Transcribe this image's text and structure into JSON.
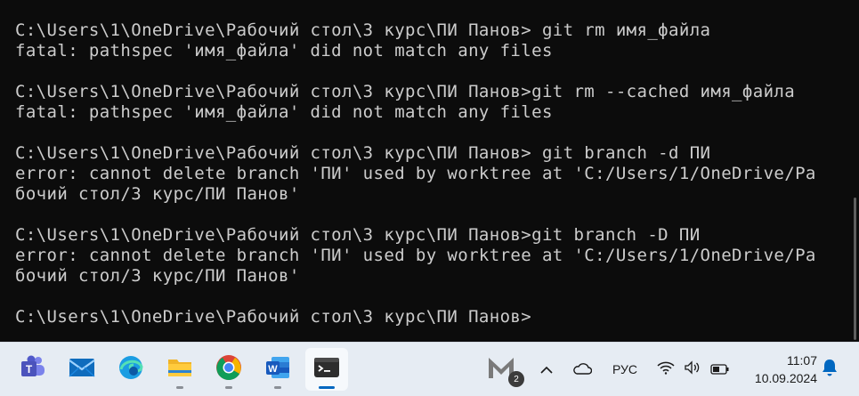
{
  "terminal": {
    "lines": [
      "C:\\Users\\1\\OneDrive\\Рабочий стол\\3 курс\\ПИ Панов> git rm имя_файла",
      "fatal: pathspec 'имя_файла' did not match any files",
      "",
      "C:\\Users\\1\\OneDrive\\Рабочий стол\\3 курс\\ПИ Панов>git rm --cached имя_файла",
      "fatal: pathspec 'имя_файла' did not match any files",
      "",
      "C:\\Users\\1\\OneDrive\\Рабочий стол\\3 курс\\ПИ Панов> git branch -d ПИ",
      "error: cannot delete branch 'ПИ' used by worktree at 'C:/Users/1/OneDrive/Ра",
      "бочий стол/3 курс/ПИ Панов'",
      "",
      "C:\\Users\\1\\OneDrive\\Рабочий стол\\3 курс\\ПИ Панов>git branch -D ПИ",
      "error: cannot delete branch 'ПИ' used by worktree at 'C:/Users/1/OneDrive/Ра",
      "бочий стол/3 курс/ПИ Панов'",
      "",
      "C:\\Users\\1\\OneDrive\\Рабочий стол\\3 курс\\ПИ Панов>"
    ]
  },
  "taskbar": {
    "apps": [
      {
        "icon": "teams-icon",
        "name": "taskbar-app-teams",
        "running": false
      },
      {
        "icon": "mail-icon",
        "name": "taskbar-app-mail",
        "running": false
      },
      {
        "icon": "edge-icon",
        "name": "taskbar-app-edge",
        "running": false
      },
      {
        "icon": "file-explorer-icon",
        "name": "taskbar-app-file-explorer",
        "running": true
      },
      {
        "icon": "chrome-icon",
        "name": "taskbar-app-chrome",
        "running": true
      },
      {
        "icon": "word-icon",
        "name": "taskbar-app-word",
        "running": true
      },
      {
        "icon": "terminal-icon",
        "name": "taskbar-app-terminal",
        "running": true,
        "active": true
      }
    ],
    "tray": {
      "pinned_app_icon": "m-app-icon",
      "badge_count": "2",
      "overflow_icon": "chevron-up-icon",
      "cloud_icon": "onedrive-cloud-icon",
      "language": "РУС",
      "wifi_icon": "wifi-icon",
      "volume_icon": "volume-icon",
      "battery_icon": "battery-icon",
      "notification_icon": "bell-icon"
    },
    "clock": {
      "time": "11:07",
      "date": "10.09.2024"
    }
  },
  "colors": {
    "terminal_bg": "#0c0c0c",
    "terminal_fg": "#cccccc",
    "taskbar_bg": "#e6ecf3",
    "accent": "#0067c0"
  }
}
